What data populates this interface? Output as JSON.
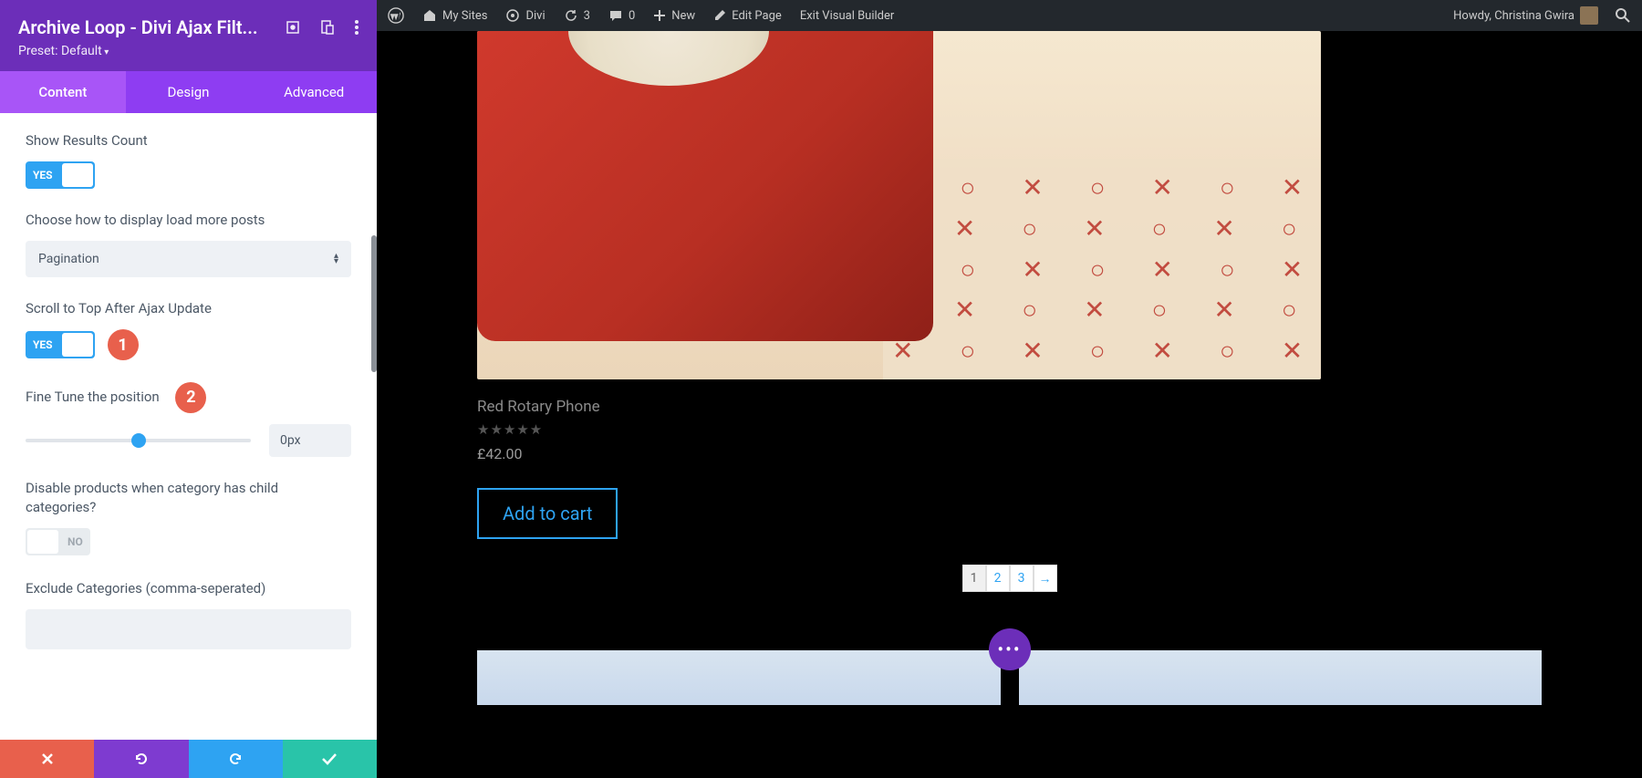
{
  "sidebar": {
    "title": "Archive Loop - Divi Ajax Filt...",
    "preset": "Preset: Default",
    "tabs": {
      "content": "Content",
      "design": "Design",
      "advanced": "Advanced"
    },
    "fields": {
      "show_results": {
        "label": "Show Results Count",
        "value": "YES"
      },
      "load_more": {
        "label": "Choose how to display load more posts",
        "value": "Pagination"
      },
      "scroll_top": {
        "label": "Scroll to Top After Ajax Update",
        "value": "YES",
        "badge": "1"
      },
      "fine_tune": {
        "label": "Fine Tune the position",
        "value": "0px",
        "badge": "2"
      },
      "disable_products": {
        "label": "Disable products when category has child categories?",
        "value": "NO"
      },
      "exclude_cats": {
        "label": "Exclude Categories (comma-seperated)",
        "value": ""
      }
    }
  },
  "wpbar": {
    "my_sites": "My Sites",
    "site_name": "Divi",
    "updates": "3",
    "comments": "0",
    "new": "New",
    "edit": "Edit Page",
    "exit": "Exit Visual Builder",
    "howdy": "Howdy, Christina Gwira"
  },
  "product": {
    "title": "Red Rotary Phone",
    "stars": "★★★★★",
    "price": "£42.00",
    "add_to_cart": "Add to cart"
  },
  "pagination": {
    "p1": "1",
    "p2": "2",
    "p3": "3",
    "next": "→"
  },
  "module_menu": "•••"
}
